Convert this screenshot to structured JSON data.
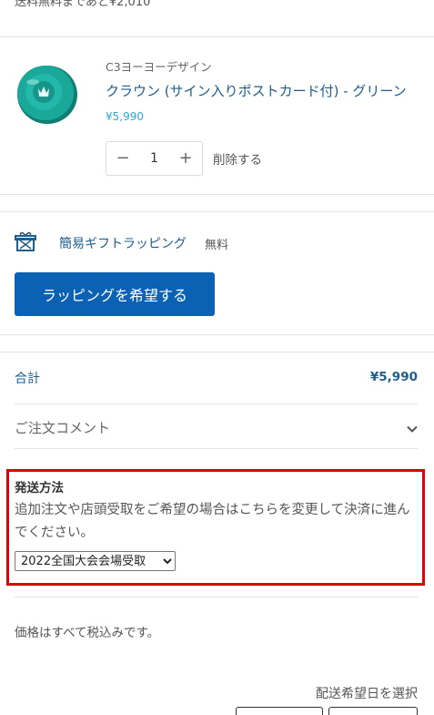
{
  "top_partial_text": "送料無料まであと¥2,010",
  "item": {
    "vendor": "C3ヨーヨーデザイン",
    "title": "クラウン (サイン入りポストカード付) - グリーン",
    "price": "¥5,990",
    "quantity": "1",
    "minus": "−",
    "plus": "+",
    "remove_label": "削除する",
    "image_icon": "yoyo-product-image",
    "colors": {
      "yoyo": "#1aa89a"
    }
  },
  "gift": {
    "icon": "gift-icon",
    "label": "簡易ギフトラッピング",
    "price": "無料",
    "button_label": "ラッピングを希望する"
  },
  "summary": {
    "total_label": "合計",
    "total_value": "¥5,990",
    "comment_label": "ご注文コメント",
    "comment_icon": "chevron-down-icon"
  },
  "shipping": {
    "heading": "発送方法",
    "description": "追加注文や店頭受取をご希望の場合はこちらを変更して決済に進んでください。",
    "selected": "2022全国大会会場受取"
  },
  "tax_note": "価格はすべて税込みです。",
  "delivery_date_label": "配送希望日を選択",
  "colors": {
    "accent": "#0b62b5",
    "link": "#1e5f8e",
    "price": "#2ca8d8",
    "highlight_border": "#e00000"
  }
}
